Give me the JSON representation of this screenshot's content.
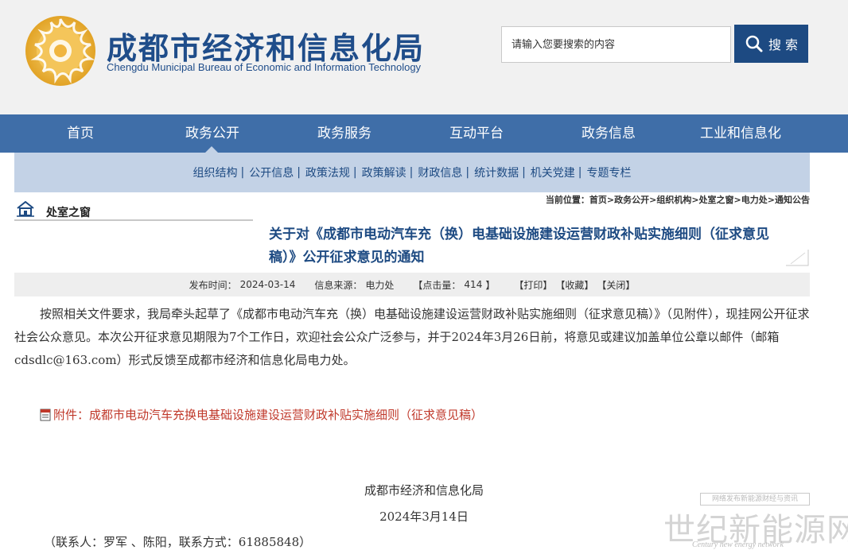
{
  "header": {
    "title_cn": "成都市经济和信息化局",
    "title_en": "Chengdu Municipal Bureau of Economic and Information Technology",
    "logo_icon": "sun-emblem-icon"
  },
  "search": {
    "placeholder": "请输入您要搜索的内容",
    "button_label": "搜 索",
    "icon": "search-icon"
  },
  "nav": {
    "items": [
      "首页",
      "政务公开",
      "政务服务",
      "互动平台",
      "政务信息",
      "工业和信息化"
    ],
    "active_index": 1
  },
  "subnav": {
    "items": [
      "组织结构",
      "公开信息",
      "政策法规",
      "政策解读",
      "财政信息",
      "统计数据",
      "机关党建",
      "专题专栏"
    ]
  },
  "section": {
    "title": "处室之窗",
    "icon": "home-icon"
  },
  "breadcrumb": {
    "label": "当前位置：",
    "path": "首页>政务公开>组织机构>处室之窗>电力处>通知公告"
  },
  "article": {
    "title": "关于对《成都市电动汽车充（换）电基础设施建设运营财政补贴实施细则（征求意见稿）》公开征求意见的通知",
    "meta": {
      "date_label": "发布时间：",
      "date": "2024-03-14",
      "source_label": "信息来源：",
      "source": "电力处",
      "clicks_label": "【点击量：",
      "clicks": "414",
      "clicks_suffix": "】",
      "print": "【打印】",
      "favorite": "【收藏】",
      "close": "【关闭】"
    },
    "body": "按照相关文件要求，我局牵头起草了《成都市电动汽车充（换）电基础设施建设运营财政补贴实施细则（征求意见稿）》（见附件），现挂网公开征求社会公众意见。本次公开征求意见期限为7个工作日，欢迎社会公众广泛参与，并于2024年3月26日前，将意见或建议加盖单位公章以邮件（邮箱cdsdlc@163.com）形式反馈至成都市经济和信息化局电力处。",
    "attachment": {
      "icon": "pdf-file-icon",
      "label": "附件：成都市电动汽车充换电基础设施建设运营财政补贴实施细则（征求意见稿）"
    },
    "signer": "成都市经济和信息化局",
    "sign_date": "2024年3月14日",
    "contact": "（联系人：罗军 、陈阳，联系方式：61885848）"
  },
  "watermark": {
    "box_text": "网络发布新能源财经与资讯",
    "main": "世纪新能源网",
    "sub": "Century new energy network"
  },
  "colors": {
    "brand_blue": "#1d4a82",
    "nav_blue": "#3f6ea8",
    "subnav_bg": "#c3d2e6",
    "attachment_red": "#c0392b"
  }
}
